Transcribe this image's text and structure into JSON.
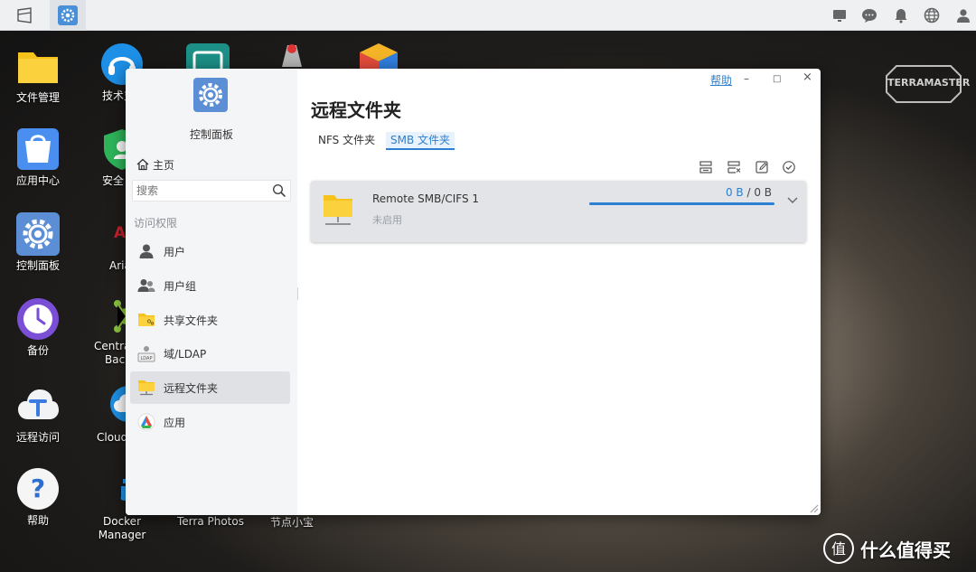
{
  "topbar": {
    "icons": [
      "window-switch-icon",
      "control-panel-app-icon",
      "monitor-icon",
      "chat-icon",
      "bell-icon",
      "globe-icon",
      "user-icon"
    ]
  },
  "desktop": {
    "col1": [
      {
        "label": "文件管理",
        "icon": "folder-icon"
      },
      {
        "label": "应用中心",
        "icon": "app-center-icon"
      },
      {
        "label": "控制面板",
        "icon": "gear-icon"
      },
      {
        "label": "备份",
        "icon": "backup-clock-icon"
      },
      {
        "label": "远程访问",
        "icon": "remote-access-icon"
      },
      {
        "label": "帮助",
        "icon": "help-icon"
      }
    ],
    "col2": [
      {
        "label": "技术支",
        "icon": "headset-icon"
      },
      {
        "label": "安全",
        "icon": "shield-icon"
      },
      {
        "label": "Aria",
        "icon": "aria-icon"
      },
      {
        "label": "Centra",
        "label2": "Back",
        "icon": "centralized-backup-icon"
      },
      {
        "label": "Cloud",
        "icon": "cloud-icon"
      },
      {
        "label": "Docker",
        "label2": "Manager",
        "icon": "docker-icon"
      }
    ],
    "bottom_partial": [
      "Terra Photos",
      "节点小宝"
    ],
    "brand": "TERRAMASTER",
    "watermark": "什么值得买"
  },
  "window": {
    "help": "帮助",
    "minimize": "–",
    "maximize": "□",
    "close": "×",
    "sidebar": {
      "title": "控制面板",
      "home": "主页",
      "search_placeholder": "搜索",
      "section": "访问权限",
      "items": [
        {
          "label": "用户",
          "icon": "user-icon"
        },
        {
          "label": "用户组",
          "icon": "user-group-icon"
        },
        {
          "label": "共享文件夹",
          "icon": "shared-folder-icon"
        },
        {
          "label": "域/LDAP",
          "icon": "ldap-icon"
        },
        {
          "label": "远程文件夹",
          "icon": "remote-folder-icon",
          "active": true
        },
        {
          "label": "应用",
          "icon": "app-icon"
        }
      ]
    },
    "main": {
      "title": "远程文件夹",
      "tabs": [
        {
          "label": "NFS 文件夹",
          "active": false
        },
        {
          "label": "SMB 文件夹",
          "active": true
        }
      ],
      "toolbar": [
        "mount-icon",
        "unmount-icon",
        "edit-icon",
        "check-icon"
      ],
      "items": [
        {
          "name": "Remote SMB/CIFS 1",
          "status": "未启用",
          "used": "0 B",
          "sep": " / ",
          "total": "0 B",
          "usage_fraction": 1.0
        }
      ]
    }
  },
  "colors": {
    "accent": "#2d7fd1",
    "folder": "#f6c21c",
    "sidebar_bg": "#f4f5f7"
  }
}
